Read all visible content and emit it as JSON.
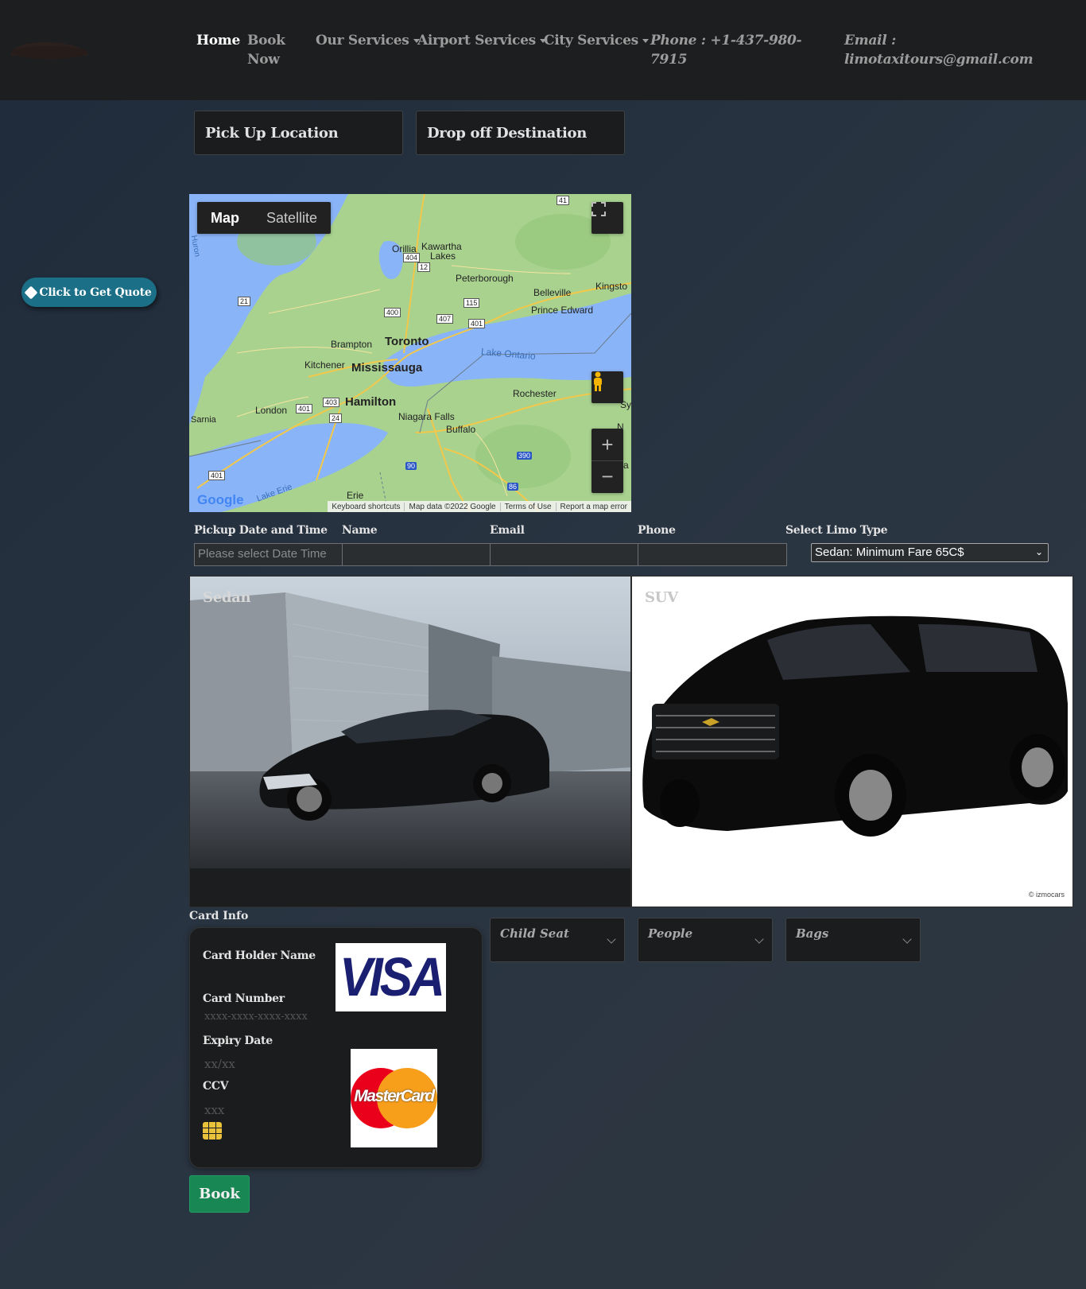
{
  "nav": {
    "home": "Home",
    "book_now_1": "Book",
    "book_now_2": "Now",
    "our_services": "Our Services",
    "airport_services": "Airport Services",
    "city_services": "City Services",
    "phone_1": "Phone : +1-437-980-",
    "phone_2": "7915",
    "email_1": "Email :",
    "email_2": "limotaxitours@gmail.com"
  },
  "locations": {
    "pickup": "Pick Up Location",
    "dropoff": "Drop off Destination"
  },
  "map": {
    "map_tab": "Map",
    "satellite_tab": "Satellite",
    "cities": {
      "orillia": "Orillia",
      "kawartha": "Kawartha",
      "lakes": "Lakes",
      "peterborough": "Peterborough",
      "belleville": "Belleville",
      "kingston": "Kingsto",
      "prince_edward": "Prince Edward",
      "brampton": "Brampton",
      "toronto": "Toronto",
      "lake_ontario": "Lake Ontario",
      "kitchener": "Kitchener",
      "mississauga": "Mississauga",
      "hamilton": "Hamilton",
      "london": "London",
      "sarnia": "Sarnia",
      "niagara": "Niagara Falls",
      "buffalo": "Buffalo",
      "rochester": "Rochester",
      "erie": "Erie",
      "lake_erie": "Lake Erie",
      "huron": "Huron",
      "sy": "Sy",
      "ne": "N E",
      "a": "a"
    },
    "shields": {
      "s41": "41",
      "s12": "12",
      "s404": "404",
      "s115": "115",
      "s21": "21",
      "s400": "400",
      "s407": "407",
      "s401a": "401",
      "s401b": "401",
      "s403": "403",
      "s24": "24",
      "s401c": "401",
      "s90": "90",
      "s390": "390",
      "s86": "86"
    },
    "google": "Google",
    "footer_keyboard": "Keyboard shortcuts",
    "footer_data": "Map data ©2022 Google",
    "footer_terms": "Terms of Use",
    "footer_report": "Report a map error"
  },
  "quote_button": "Click to Get Quote",
  "form": {
    "datetime_label": "Pickup Date and Time",
    "datetime_placeholder": "Please select Date Time",
    "name_label": "Name",
    "email_label": "Email",
    "phone_label": "Phone",
    "limo_label": "Select Limo Type",
    "limo_selected": "Sedan: Minimum Fare 65C$"
  },
  "vehicles": {
    "sedan": "Sedan",
    "suv": "SUV",
    "izmo": "© izmocars"
  },
  "card": {
    "title": "Card Info",
    "holder_label": "Card Holder Name",
    "number_label": "Card Number",
    "number_placeholder": "xxxx-xxxx-xxxx-xxxx",
    "expiry_label": "Expiry Date",
    "expiry_placeholder": "xx/xx",
    "ccv_label": "CCV",
    "ccv_placeholder": "xxx",
    "visa": "VISA",
    "mastercard": "MasterCard"
  },
  "options": {
    "child_seat": "Child Seat",
    "people": "People",
    "bags": "Bags"
  },
  "book_button": "Book",
  "colors": {
    "nav_bg": "#1c1e20",
    "accent_teal": "#1b6f86",
    "book_green": "#198754"
  }
}
